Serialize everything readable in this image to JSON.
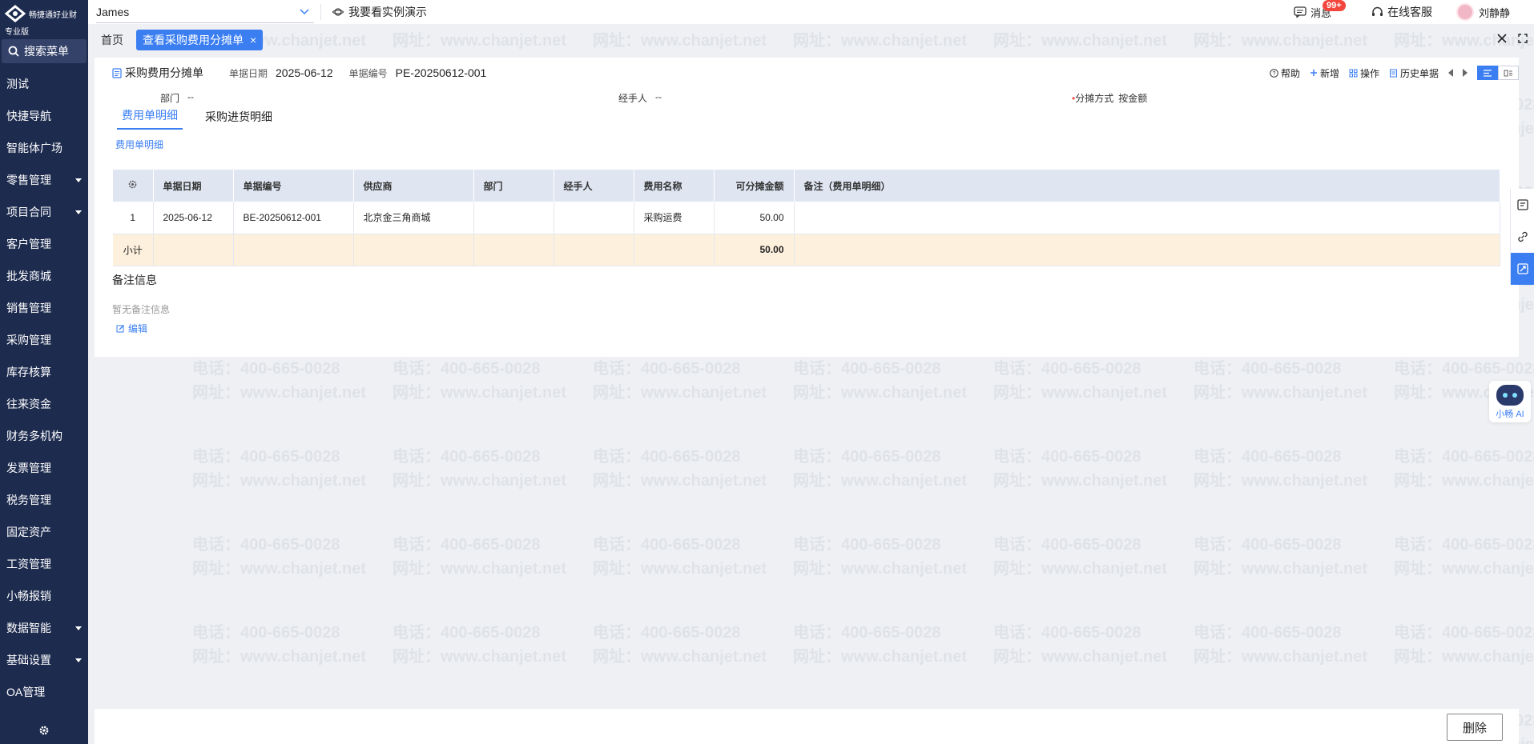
{
  "brand": {
    "logo_text": "畅捷通好业财",
    "edition": "专业版"
  },
  "sidebar": {
    "search_label": "搜索菜单",
    "items": [
      {
        "label": "测试",
        "expandable": false
      },
      {
        "label": "快捷导航",
        "expandable": false
      },
      {
        "label": "智能体广场",
        "expandable": false
      },
      {
        "label": "零售管理",
        "expandable": true
      },
      {
        "label": "项目合同",
        "expandable": true
      },
      {
        "label": "客户管理",
        "expandable": false
      },
      {
        "label": "批发商城",
        "expandable": false
      },
      {
        "label": "销售管理",
        "expandable": false
      },
      {
        "label": "采购管理",
        "expandable": false
      },
      {
        "label": "库存核算",
        "expandable": false
      },
      {
        "label": "往来资金",
        "expandable": false
      },
      {
        "label": "财务多机构",
        "expandable": false
      },
      {
        "label": "发票管理",
        "expandable": false
      },
      {
        "label": "税务管理",
        "expandable": false
      },
      {
        "label": "固定资产",
        "expandable": false
      },
      {
        "label": "工资管理",
        "expandable": false
      },
      {
        "label": "小畅报销",
        "expandable": false
      },
      {
        "label": "数据智能",
        "expandable": true
      },
      {
        "label": "基础设置",
        "expandable": true
      },
      {
        "label": "OA管理",
        "expandable": false
      }
    ]
  },
  "topbar": {
    "company": "James",
    "demo_label": "我要看实例演示",
    "messages_label": "消息",
    "messages_badge": "99+",
    "service_label": "在线客服",
    "user_name": "刘静静"
  },
  "tabs": {
    "home": "首页",
    "active": "查看采购费用分摊单",
    "close_glyph": "×"
  },
  "doc": {
    "title": "采购费用分摊单",
    "date_label": "单据日期",
    "date_value": "2025-06-12",
    "no_label": "单据编号",
    "no_value": "PE-20250612-001",
    "tools": {
      "help": "帮助",
      "new": "新增",
      "ops": "操作",
      "history": "历史单据"
    },
    "fields": {
      "dept_label": "部门",
      "dept_value": "--",
      "handler_label": "经手人",
      "handler_value": "--",
      "method_required": "•",
      "method_label": "分摊方式",
      "method_value": "按金额"
    },
    "subtabs": [
      "费用单明细",
      "采购进货明细"
    ],
    "section_title": "费用单明细"
  },
  "table": {
    "headers": [
      "单据日期",
      "单据编号",
      "供应商",
      "部门",
      "经手人",
      "费用名称",
      "可分摊金额",
      "备注（费用单明细）"
    ],
    "rows": [
      {
        "idx": "1",
        "date": "2025-06-12",
        "no": "BE-20250612-001",
        "supplier": "北京金三角商城",
        "dept": "",
        "handler": "",
        "expense": "采购运费",
        "amount": "50.00",
        "remark": ""
      }
    ],
    "subtotal_label": "小计",
    "subtotal_amount": "50.00"
  },
  "remarks": {
    "title": "备注信息",
    "empty": "暂无备注信息",
    "edit": "编辑"
  },
  "ai": {
    "label": "小畅 AI"
  },
  "footer": {
    "delete_label": "删除"
  },
  "watermark": {
    "line1": "电话：400-665-0028",
    "line2": "网址：www.chanjet.net"
  },
  "colors": {
    "sidebar_bg": "#1d2b4f",
    "accent": "#3a7ef2",
    "subtotal_bg": "#fdf0dd",
    "badge": "#f3463d"
  }
}
